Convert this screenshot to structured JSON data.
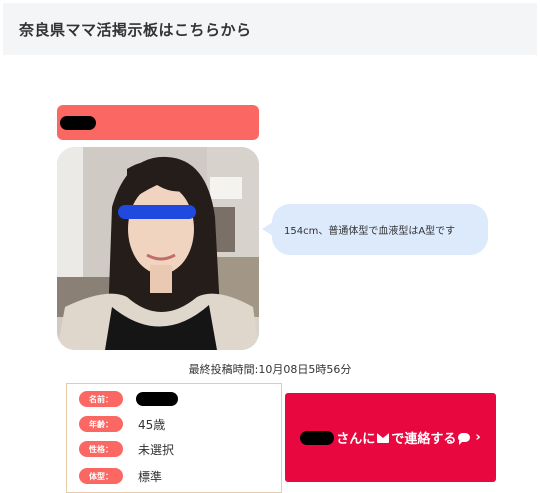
{
  "header": {
    "title": "奈良県ママ活掲示板はこちらから"
  },
  "post": {
    "message": "154cm、普通体型で血液型はA型です",
    "last_post": "最終投稿時間:10月08日5時56分"
  },
  "profile": {
    "fields": [
      {
        "label": "名前：",
        "value": ""
      },
      {
        "label": "年齢：",
        "value": "45歳"
      },
      {
        "label": "性格：",
        "value": "未選択"
      },
      {
        "label": "体型：",
        "value": "標準"
      }
    ]
  },
  "contact_button": {
    "text_a": "さんに",
    "text_b": "で連絡する",
    "arrow": "›",
    "icons": [
      "mail-icon",
      "chat-bubble-icon"
    ]
  },
  "colors": {
    "accent_salmon": "#fb6762",
    "contact_red": "#e8073e",
    "bubble_blue": "#dceafb",
    "header_bg": "#f4f5f7"
  }
}
